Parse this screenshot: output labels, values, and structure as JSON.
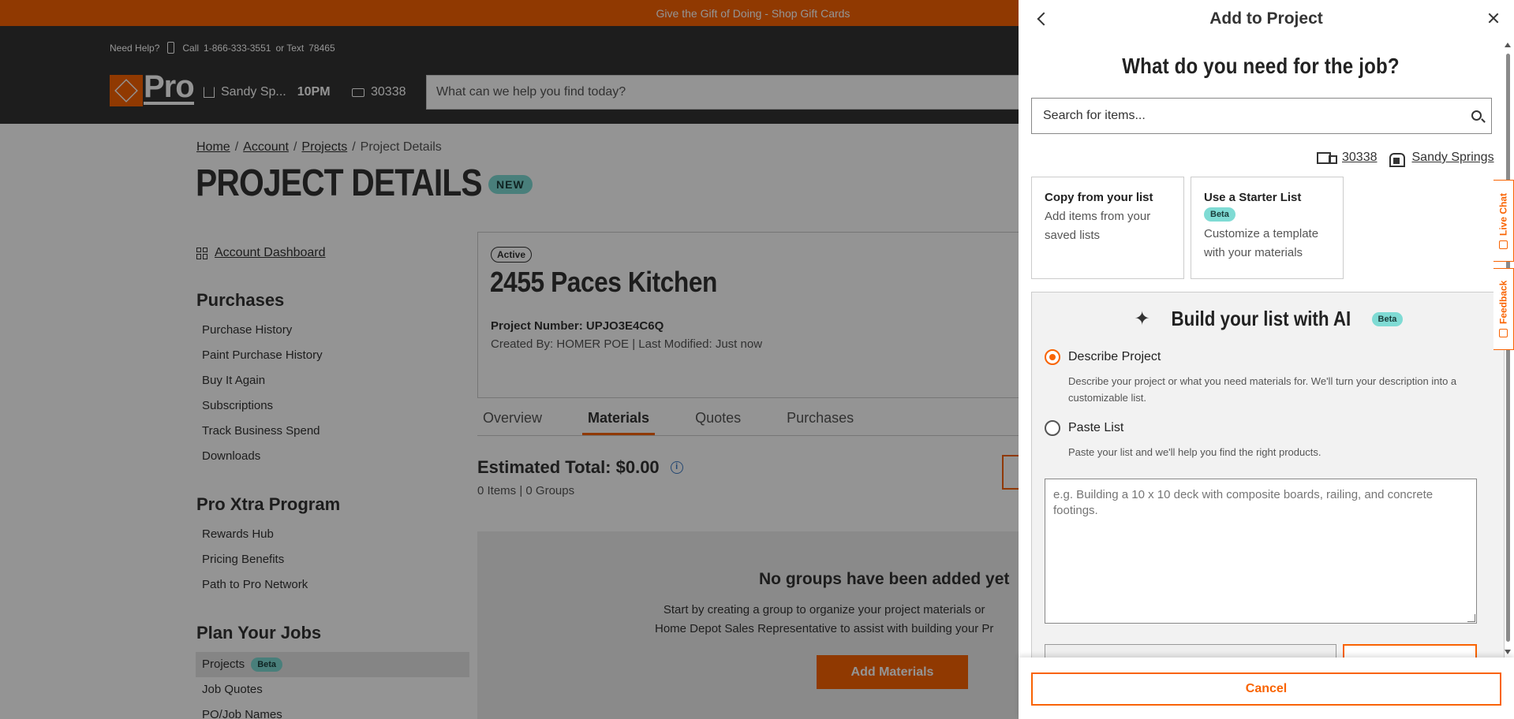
{
  "promo": {
    "text": "Give the Gift of Doing - Shop Gift Cards"
  },
  "header": {
    "need_help": "Need Help?",
    "call": "Call",
    "phone": "1-866-333-3551",
    "or_text": "or Text",
    "text_number": "78465",
    "logo_text": "Pro",
    "store_name": "Sandy Sp...",
    "store_hours": "10PM",
    "zip": "30338",
    "search_placeholder": "What can we help you find today?"
  },
  "breadcrumbs": {
    "home": "Home",
    "account": "Account",
    "projects": "Projects",
    "current": "Project Details"
  },
  "page": {
    "title": "PROJECT DETAILS",
    "new_badge": "NEW"
  },
  "sidebar": {
    "dashboard": "Account Dashboard",
    "purchases_heading": "Purchases",
    "purchases": [
      "Purchase History",
      "Paint Purchase History",
      "Buy It Again",
      "Subscriptions",
      "Track Business Spend",
      "Downloads"
    ],
    "proxtra_heading": "Pro Xtra Program",
    "proxtra": [
      "Rewards Hub",
      "Pricing Benefits",
      "Path to Pro Network"
    ],
    "plan_heading": "Plan Your Jobs",
    "projects": "Projects",
    "projects_badge": "Beta",
    "job_quotes": "Job Quotes",
    "po_names": "PO/Job Names"
  },
  "project": {
    "status": "Active",
    "name": "2455 Paces Kitchen",
    "number_label": "Project Number: UPJO3E4C6Q",
    "meta": "Created By: HOMER POE | Last Modified: Just now"
  },
  "tabs": [
    "Overview",
    "Materials",
    "Quotes",
    "Purchases"
  ],
  "estimate": {
    "total": "Estimated Total: $0.00",
    "sub": "0 Items | 0 Groups",
    "info": "i"
  },
  "empty": {
    "title": "No groups have been added yet",
    "line1": "Start by creating a group to organize your project materials or",
    "line2": "Home Depot Sales Representative to assist with building your Pr",
    "button": "Add Materials"
  },
  "drawer": {
    "title": "Add to Project",
    "question": "What do you need for the job?",
    "search_placeholder": "Search for items...",
    "zip": "30338",
    "store": "Sandy Springs",
    "copy_title": "Copy from your list",
    "copy_desc": "Add items from your saved lists",
    "starter_title": "Use a Starter List",
    "starter_badge": "Beta",
    "starter_desc": "Customize a template with your materials",
    "ai_title": "Build your list with AI",
    "ai_badge": "Beta",
    "describe_label": "Describe Project",
    "describe_desc": "Describe your project or what you need materials for. We'll turn your description into a customizable list.",
    "paste_label": "Paste List",
    "paste_desc": "Paste your list and we'll help you find the right products.",
    "textarea_placeholder": "e.g. Building a 10 x 10 deck with composite boards, railing, and concrete footings.",
    "cancel": "Cancel"
  },
  "side_tabs": {
    "chat": "Live Chat",
    "feedback": "Feedback"
  },
  "colors": {
    "brand_orange": "#f96302",
    "beta_teal": "#7fdbd4",
    "header_dark": "#333333"
  }
}
